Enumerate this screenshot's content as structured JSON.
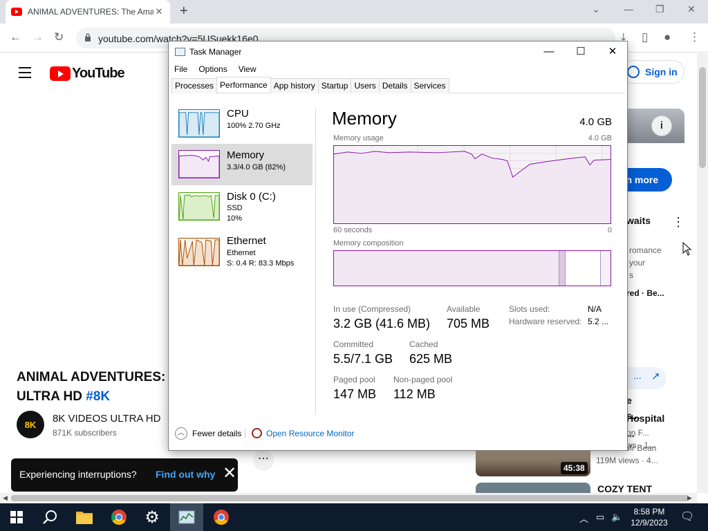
{
  "browser": {
    "tab_title": "ANIMAL ADVENTURES: The Ama",
    "tab_close": "✕",
    "new_tab": "+",
    "url": "youtube.com/watch?v=5USuekk16e0"
  },
  "youtube": {
    "logo_text": "YouTube",
    "sign_in": "Sign in",
    "video_title_line1": "ANIMAL ADVENTURES: T",
    "video_title_line2": "ULTRA HD ",
    "video_title_tag": "#8K",
    "channel_avatar": "8K",
    "channel_name": "8K VIDEOS ULTRA HD",
    "channel_subs": "871K subscribers",
    "more_actions": "⋯",
    "toast_message": "Experiencing interruptions?",
    "toast_link": "Find out why",
    "toast_close": "✕",
    "right": {
      "learn_more": "rn more",
      "waits": "waits",
      "romance": "romance",
      "your": "your",
      "s": "s",
      "red_be": "red · Be...",
      "e": "e",
      "s_dots": "s...",
      "onf": "on F...",
      "ws": "ws · 1...",
      "hospital": "Hospital",
      "hospital_dots": "...",
      "mrbean_channel": "Classic Mr Bean",
      "mrbean_views": "119M views · 4...",
      "duration": "45:38",
      "cozy": "COZY TENT"
    }
  },
  "taskmanager": {
    "title": "Task Manager",
    "menu": [
      "File",
      "Options",
      "View"
    ],
    "tabs": [
      "Processes",
      "Performance",
      "App history",
      "Startup",
      "Users",
      "Details",
      "Services"
    ],
    "active_tab": "Performance",
    "side": [
      {
        "label": "CPU",
        "sub1": "100%  2.70 GHz",
        "sub2": ""
      },
      {
        "label": "Memory",
        "sub1": "3.3/4.0 GB (82%)",
        "sub2": ""
      },
      {
        "label": "Disk 0 (C:)",
        "sub1": "SSD",
        "sub2": "10%"
      },
      {
        "label": "Ethernet",
        "sub1": "Ethernet",
        "sub2": "S: 0.4  R: 83.3 Mbps"
      }
    ],
    "heading": "Memory",
    "total": "4.0 GB",
    "usage_label": "Memory usage",
    "usage_max": "4.0 GB",
    "time_label": "60 seconds",
    "time_zero": "0",
    "composition_label": "Memory composition",
    "stats": {
      "in_use_label": "In use (Compressed)",
      "in_use_value": "3.2 GB (41.6 MB)",
      "available_label": "Available",
      "available_value": "705 MB",
      "slots_label": "Slots used:",
      "slots_value": "N/A",
      "hw_label": "Hardware reserved:",
      "hw_value": "5.2 ...",
      "committed_label": "Committed",
      "committed_value": "5.5/7.1 GB",
      "cached_label": "Cached",
      "cached_value": "625 MB",
      "paged_label": "Paged pool",
      "paged_value": "147 MB",
      "nonpaged_label": "Non-paged pool",
      "nonpaged_value": "112 MB"
    },
    "fewer_details": "Fewer details",
    "open_resource_monitor": "Open Resource Monitor",
    "memory_usage_pct": 82
  },
  "taskbar": {
    "time": "8:58 PM",
    "date": "12/9/2023"
  },
  "colors": {
    "memory_purple": "#8b12ae",
    "cpu_blue": "#117dbb",
    "disk_green": "#4da60c",
    "ethernet_orange": "#a74f01",
    "youtube_red": "#ff0000",
    "link_blue": "#065fd4"
  }
}
